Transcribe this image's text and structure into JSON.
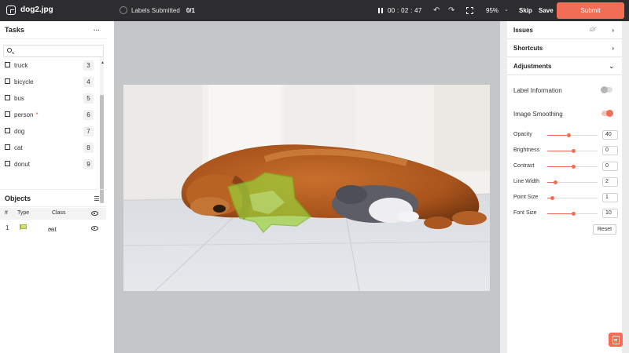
{
  "app": {
    "filename": "dog2.jpg"
  },
  "header": {
    "labels_submitted_label": "Labels Submitted",
    "labels_submitted_count": "0/1",
    "timer": "00 : 02 : 47",
    "zoom": "95%",
    "skip_label": "Skip",
    "save_label": "Save",
    "submit_label": "Submit"
  },
  "tasks": {
    "title": "Tasks",
    "menu": "···",
    "items": [
      {
        "label": "truck",
        "count": "3",
        "star": ""
      },
      {
        "label": "bicycle",
        "count": "4",
        "star": ""
      },
      {
        "label": "bus",
        "count": "5",
        "star": ""
      },
      {
        "label": "person",
        "count": "6",
        "star": "*"
      },
      {
        "label": "dog",
        "count": "7",
        "star": ""
      },
      {
        "label": "cat",
        "count": "8",
        "star": ""
      },
      {
        "label": "donut",
        "count": "9",
        "star": ""
      }
    ]
  },
  "objects": {
    "title": "Objects",
    "columns": {
      "index": "#",
      "type": "Type",
      "class": "Class"
    },
    "rows": [
      {
        "index": "1",
        "class": "cat"
      }
    ]
  },
  "right_panel": {
    "issues_label": "Issues",
    "shortcuts_label": "Shortcuts",
    "adjustments_label": "Adjustments",
    "label_information_label": "Label Information",
    "label_information_on": false,
    "image_smoothing_label": "Image Smoothing",
    "image_smoothing_on": true,
    "sliders": [
      {
        "label": "Opacity",
        "value": "40",
        "level": 0.42
      },
      {
        "label": "Brightness",
        "value": "0",
        "level": 0.52
      },
      {
        "label": "Contrast",
        "value": "0",
        "level": 0.52
      },
      {
        "label": "Line Width",
        "value": "2",
        "level": 0.15
      },
      {
        "label": "Point Size",
        "value": "1",
        "level": 0.1
      },
      {
        "label": "Font Size",
        "value": "10",
        "level": 0.52
      }
    ],
    "reset_label": "Reset"
  },
  "colors": {
    "accent": "#f26d55",
    "topbar": "#2d2d2f",
    "annotation": "#9bd33a"
  }
}
